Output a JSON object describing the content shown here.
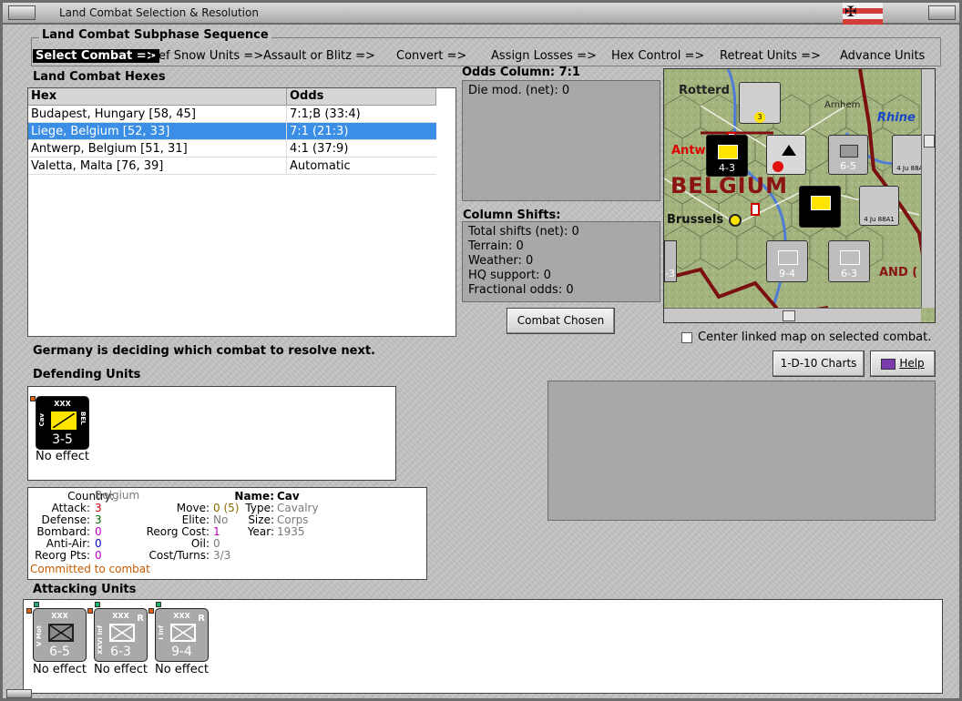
{
  "window": {
    "title": "Land Combat Selection & Resolution"
  },
  "sequence": {
    "title": "Land Combat Subphase Sequence",
    "steps": [
      {
        "label": "Select Combat =>",
        "active": true
      },
      {
        "label": "Def Snow Units =>"
      },
      {
        "label": "Assault or Blitz =>"
      },
      {
        "label": "Convert =>"
      },
      {
        "label": "Assign Losses =>"
      },
      {
        "label": "Hex Control =>"
      },
      {
        "label": "Retreat Units =>"
      },
      {
        "label": "Advance Units"
      }
    ]
  },
  "hexes": {
    "title": "Land Combat Hexes",
    "columns": [
      "Hex",
      "Odds"
    ],
    "rows": [
      {
        "hex": "Budapest, Hungary [58, 45]",
        "odds": "7:1;B (33:4)"
      },
      {
        "hex": "Liege, Belgium [52, 33]",
        "odds": "7:1 (21:3)",
        "selected": true
      },
      {
        "hex": "Antwerp, Belgium [51, 31]",
        "odds": "4:1 (37:9)"
      },
      {
        "hex": "Valetta, Malta [76, 39]",
        "odds": "Automatic"
      }
    ]
  },
  "odds": {
    "title": "Odds Column: 7:1",
    "die_mod": "Die mod. (net): 0"
  },
  "shifts": {
    "title": "Column Shifts:",
    "lines": [
      "Total shifts (net): 0",
      "Terrain: 0",
      "Weather: 0",
      "HQ support: 0",
      "Fractional odds: 0"
    ]
  },
  "buttons": {
    "combat_chosen": "Combat Chosen",
    "charts": "1-D-10 Charts",
    "help": "Help"
  },
  "map": {
    "labels": {
      "rotterdam": "Rotterd",
      "arnhem": "Arnhem",
      "rhine": "Rhine",
      "antwerp": "Antw",
      "belgium": "BELGIUM",
      "brussels": "Brussels",
      "and": "AND ("
    },
    "counters": [
      {
        "value": "4-3"
      },
      {
        "value": "3"
      },
      {
        "value": "6-5"
      },
      {
        "value": "9-4"
      },
      {
        "value": "6-3"
      },
      {
        "value": "4 Ju 88A1"
      },
      {
        "value": "4 Ju 88A1"
      },
      {
        "value": "-3"
      }
    ]
  },
  "center_map": {
    "label": "Center linked map on selected combat.",
    "checked": false
  },
  "status": "Germany is deciding which combat to resolve next.",
  "defending": {
    "title": "Defending Units",
    "units": [
      {
        "value": "3-5",
        "size": "XXX",
        "type_label": "Cav",
        "nation": "BEL",
        "result": "No effect",
        "color": "#000000",
        "symbol_color": "#ffe400"
      }
    ]
  },
  "unit_info": {
    "country_label": "Country:",
    "country": "Belgium",
    "attack_label": "Attack:",
    "attack": "3",
    "defense_label": "Defense:",
    "defense": "3",
    "bombard_label": "Bombard:",
    "bombard": "0",
    "antiair_label": "Anti-Air:",
    "antiair": "0",
    "reorg_pts_label": "Reorg Pts:",
    "reorg_pts": "0",
    "committed": "Committed to combat",
    "move_label": "Move:",
    "move": "0 (5)",
    "elite_label": "Elite:",
    "elite": "No",
    "reorg_cost_label": "Reorg Cost:",
    "reorg_cost": "1",
    "oil_label": "Oil:",
    "oil": "0",
    "cost_turns_label": "Cost/Turns:",
    "cost_turns": "3/3",
    "name_label": "Name:",
    "name": "Cav",
    "type_label": "Type:",
    "type": "Cavalry",
    "size_label": "Size:",
    "size": "Corps",
    "year_label": "Year:",
    "year": "1935"
  },
  "attacking": {
    "title": "Attacking Units",
    "units": [
      {
        "value": "6-5",
        "size": "XXX",
        "type_label": "V Mot",
        "result": "No effect"
      },
      {
        "value": "6-3",
        "size": "XXX",
        "type_label": "XXVI Inf",
        "result": "No effect",
        "reserve": "R"
      },
      {
        "value": "9-4",
        "size": "XXX",
        "type_label": "I Inf",
        "result": "No effect",
        "reserve": "R"
      }
    ]
  },
  "colors": {
    "selected_row": "#3a8ee6",
    "german_counter": "#a9a9a9",
    "committed_text": "#c65a00",
    "value_gray": "#7a7a7a",
    "attack_red": "#d00000",
    "defense_green": "#006b00",
    "bombard_magenta": "#c000c0",
    "antiair_blue": "#0000c0"
  }
}
